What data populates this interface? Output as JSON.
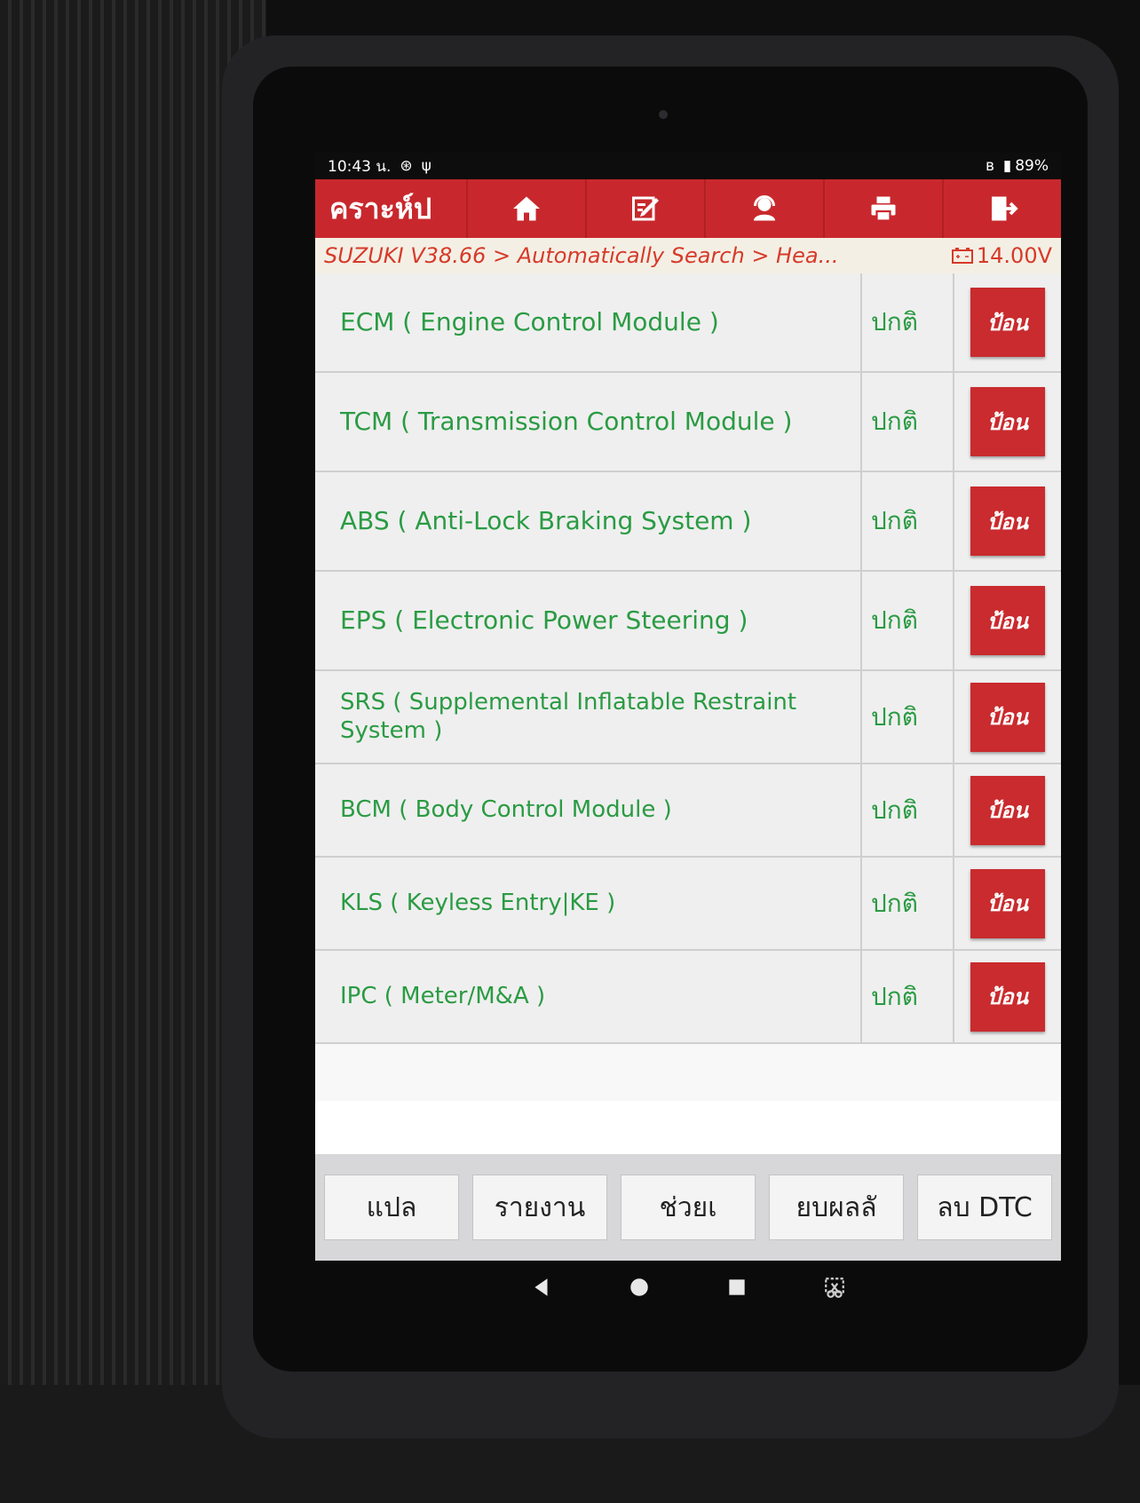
{
  "status_bar": {
    "time": "10:43 น.",
    "battery": "89%"
  },
  "top_bar": {
    "brand": "คราะห์ป",
    "icons": [
      "home-icon",
      "edit-icon",
      "user-support-icon",
      "printer-icon",
      "exit-icon"
    ]
  },
  "breadcrumb": {
    "path": "SUZUKI V38.66 > Automatically Search > Hea...",
    "voltage": "14.00V"
  },
  "modules": [
    {
      "name": "ECM ( Engine Control Module )",
      "status": "ปกติ",
      "action": "ป้อน"
    },
    {
      "name": "TCM ( Transmission Control Module )",
      "status": "ปกติ",
      "action": "ป้อน"
    },
    {
      "name": "ABS ( Anti-Lock Braking System )",
      "status": "ปกติ",
      "action": "ป้อน"
    },
    {
      "name": "EPS ( Electronic Power Steering )",
      "status": "ปกติ",
      "action": "ป้อน"
    },
    {
      "name": "SRS ( Supplemental Inflatable Restraint System )",
      "status": "ปกติ",
      "action": "ป้อน"
    },
    {
      "name": "BCM ( Body Control Module )",
      "status": "ปกติ",
      "action": "ป้อน"
    },
    {
      "name": "KLS ( Keyless Entry|KE )",
      "status": "ปกติ",
      "action": "ป้อน"
    },
    {
      "name": "IPC ( Meter/M&A )",
      "status": "ปกติ",
      "action": "ป้อน"
    }
  ],
  "footer": {
    "buttons": [
      "แปล",
      "รายงาน",
      "ช่วยเ",
      "ยบผลลั",
      "ลบ DTC"
    ]
  },
  "colors": {
    "accent_red": "#c8282d",
    "module_text_green": "#2a9b43",
    "breadcrumb_text": "#d63a2a"
  }
}
